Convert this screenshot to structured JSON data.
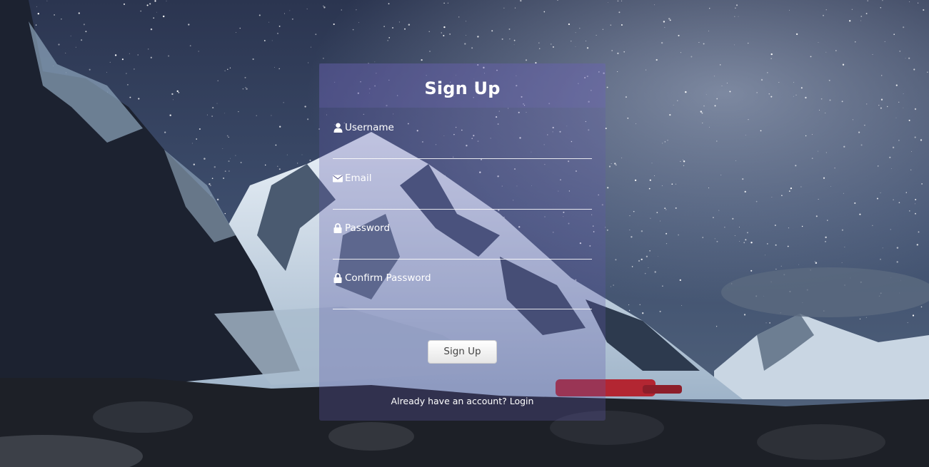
{
  "form": {
    "title": "Sign Up",
    "fields": [
      {
        "label": "Username",
        "icon": "user-icon",
        "value": ""
      },
      {
        "label": "Email",
        "icon": "envelope-icon",
        "value": ""
      },
      {
        "label": "Password",
        "icon": "lock-icon",
        "value": ""
      },
      {
        "label": "Confirm Password",
        "icon": "lock-icon",
        "value": ""
      }
    ],
    "submit_label": "Sign Up",
    "login_prompt": "Already have an account?",
    "login_link": "Login"
  },
  "colors": {
    "card_overlay": "#5f5aaa",
    "text": "#ffffff",
    "button_bg": "#f2f2f2",
    "button_text": "#444444"
  }
}
